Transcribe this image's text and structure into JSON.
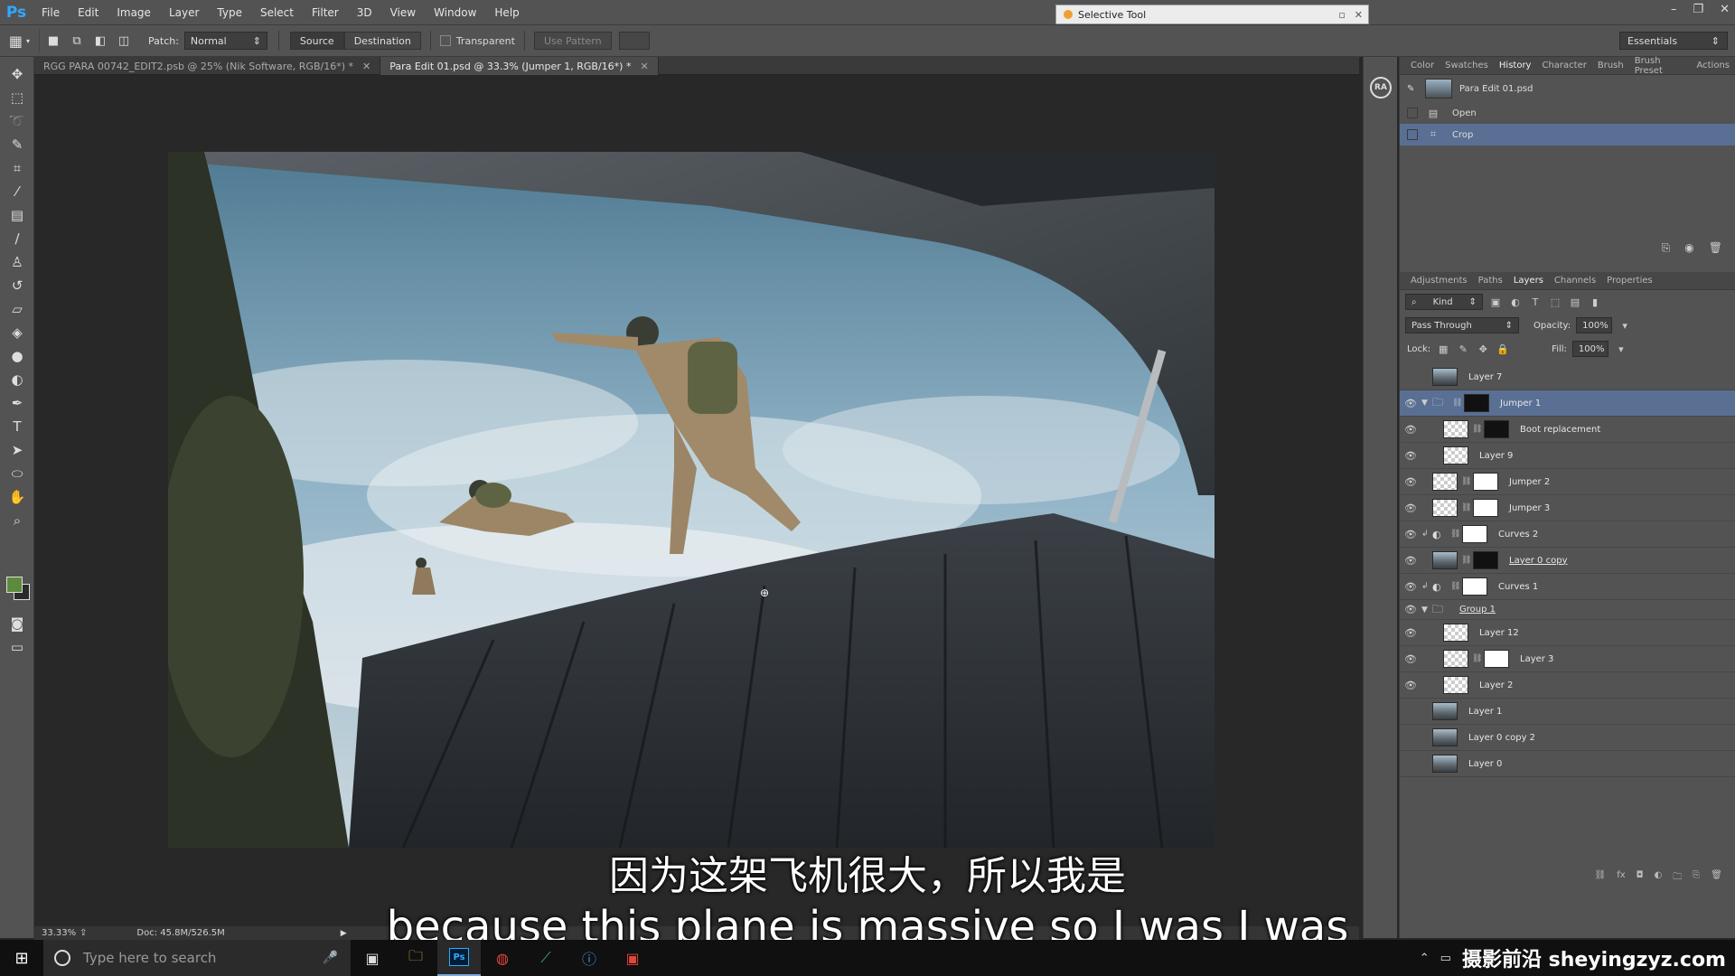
{
  "app": {
    "logo": "Ps",
    "menus": [
      "File",
      "Edit",
      "Image",
      "Layer",
      "Type",
      "Select",
      "Filter",
      "3D",
      "View",
      "Window",
      "Help"
    ],
    "floating_title": "Selective Tool",
    "workspace": "Essentials"
  },
  "options": {
    "patch_label": "Patch:",
    "patch_value": "Normal",
    "source": "Source",
    "destination": "Destination",
    "transparent": "Transparent",
    "use_pattern": "Use Pattern"
  },
  "tools": [
    "move-icon",
    "marquee-icon",
    "lasso-icon",
    "quick-select-icon",
    "crop-icon",
    "eyedropper-icon",
    "healing-brush-icon",
    "brush-icon",
    "clone-stamp-icon",
    "history-brush-icon",
    "eraser-icon",
    "paint-bucket-icon",
    "blur-icon",
    "dodge-icon",
    "pen-icon",
    "type-icon",
    "path-select-icon",
    "shape-icon",
    "hand-icon",
    "zoom-icon"
  ],
  "doc_tabs": [
    {
      "label": "RGG PARA 00742_EDIT2.psb @ 25% (Nik Software, RGB/16*) *",
      "active": false
    },
    {
      "label": "Para Edit 01.psd @ 33.3% (Jumper 1, RGB/16*) *",
      "active": true
    }
  ],
  "status": {
    "zoom": "33.33%",
    "doc": "Doc: 45.8M/526.5M"
  },
  "collapsed_icon": "RA",
  "history_tabs": [
    {
      "label": "Color",
      "active": false
    },
    {
      "label": "Swatches",
      "active": false
    },
    {
      "label": "History",
      "active": true
    },
    {
      "label": "Character",
      "active": false
    },
    {
      "label": "Brush",
      "active": false
    },
    {
      "label": "Brush Preset",
      "active": false
    },
    {
      "label": "Actions",
      "active": false
    }
  ],
  "history": {
    "snapshot": "Para Edit 01.psd",
    "items": [
      {
        "label": "Open",
        "selected": false
      },
      {
        "label": "Crop",
        "selected": true
      }
    ]
  },
  "layers_tabs": [
    {
      "label": "Adjustments",
      "active": false
    },
    {
      "label": "Paths",
      "active": false
    },
    {
      "label": "Layers",
      "active": true
    },
    {
      "label": "Channels",
      "active": false
    },
    {
      "label": "Properties",
      "active": false
    }
  ],
  "layers_controls": {
    "kind": "Kind",
    "blend_mode": "Pass Through",
    "opacity_label": "Opacity:",
    "opacity_value": "100%",
    "lock_label": "Lock:",
    "fill_label": "Fill:",
    "fill_value": "100%"
  },
  "layers": [
    {
      "name": "Layer 7",
      "visible": false
    },
    {
      "name": "Jumper 1",
      "visible": true,
      "selected": true
    },
    {
      "name": "Boot replacement",
      "visible": true
    },
    {
      "name": "Layer 9",
      "visible": true
    },
    {
      "name": "Jumper 2",
      "visible": true
    },
    {
      "name": "Jumper 3",
      "visible": true
    },
    {
      "name": "Curves 2",
      "visible": true
    },
    {
      "name": "Layer 0 copy",
      "visible": true
    },
    {
      "name": "Curves 1",
      "visible": true
    },
    {
      "name": "Group 1",
      "visible": true
    },
    {
      "name": "Layer 12",
      "visible": true
    },
    {
      "name": "Layer 3",
      "visible": true
    },
    {
      "name": "Layer 2",
      "visible": true
    },
    {
      "name": "Layer 1",
      "visible": false
    },
    {
      "name": "Layer 0 copy 2",
      "visible": false
    },
    {
      "name": "Layer 0",
      "visible": false
    }
  ],
  "subtitles": {
    "chinese": "因为这架飞机很大，所以我是",
    "english": "because this plane is massive so I was I was"
  },
  "taskbar": {
    "search_placeholder": "Type here to search",
    "watermark": "摄影前沿 sheyingzyz.com"
  }
}
